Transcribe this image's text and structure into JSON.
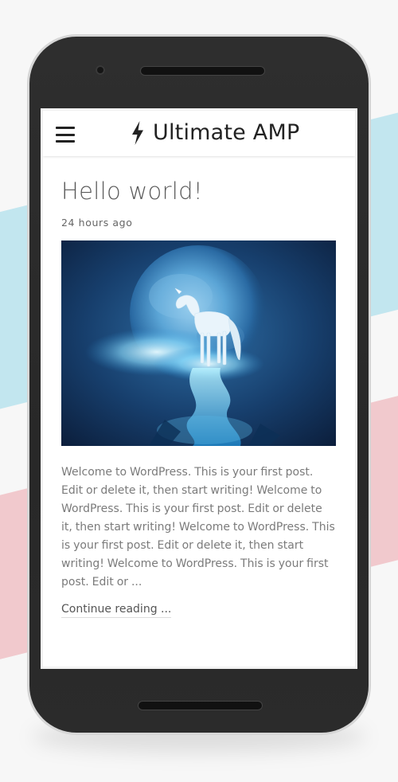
{
  "app": {
    "title": "Ultimate AMP",
    "brand_icon": "lightning-bolt-icon",
    "menu_icon": "hamburger-menu-icon"
  },
  "post": {
    "title": "Hello world!",
    "meta": "24 hours ago",
    "image_alt": "unicorn-under-moon-image",
    "excerpt": "Welcome to WordPress. This is your first post. Edit or delete it, then start writing! Welcome to WordPress. This is your first post. Edit or delete it, then   start writing! Welcome to WordPress. This is your first post. Edit or delete it, then start writing! Welcome to WordPress. This is your first post. Edit or ...",
    "continue_label": "Continue reading ..."
  },
  "colors": {
    "ribbon_blue": "#c2e6ef",
    "ribbon_pink": "#f1c9cd",
    "phone_body": "#2b2b2b",
    "title_text": "#5a5a5a",
    "body_text": "#7b7b7b"
  }
}
